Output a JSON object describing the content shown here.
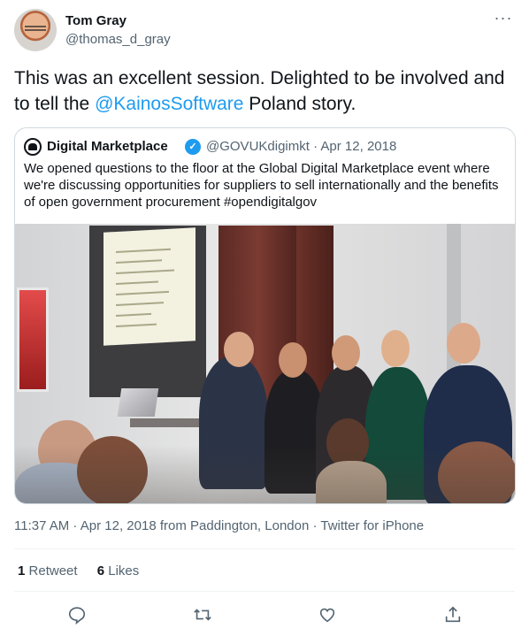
{
  "author": {
    "name": "Tom Gray",
    "handle": "@thomas_d_gray"
  },
  "tweet": {
    "text_before": "This was an excellent session. Delighted to be involved and to tell the ",
    "mention": "@KainosSoftware",
    "text_after": " Poland story."
  },
  "quote": {
    "name": "Digital Marketplace",
    "handle_date": "@GOVUKdigimkt · Apr 12, 2018",
    "text": "We opened questions to the floor at the Global Digital Marketplace event where we're discussing opportunities for suppliers to sell internationally and the benefits of open government procurement #opendigitalgov"
  },
  "meta": {
    "time": "11:37 AM",
    "date": "Apr 12, 2018",
    "location": "from Paddington, London",
    "source": "Twitter for iPhone"
  },
  "stats": {
    "retweets_count": "1",
    "retweets_label": "Retweet",
    "likes_count": "6",
    "likes_label": "Likes"
  },
  "icons": {
    "more": "more-icon",
    "verified": "verified-badge-icon",
    "reply": "reply-icon",
    "retweet": "retweet-icon",
    "like": "heart-icon",
    "share": "share-icon"
  },
  "colors": {
    "accent": "#1d9bf0",
    "secondary_text": "#536471"
  }
}
